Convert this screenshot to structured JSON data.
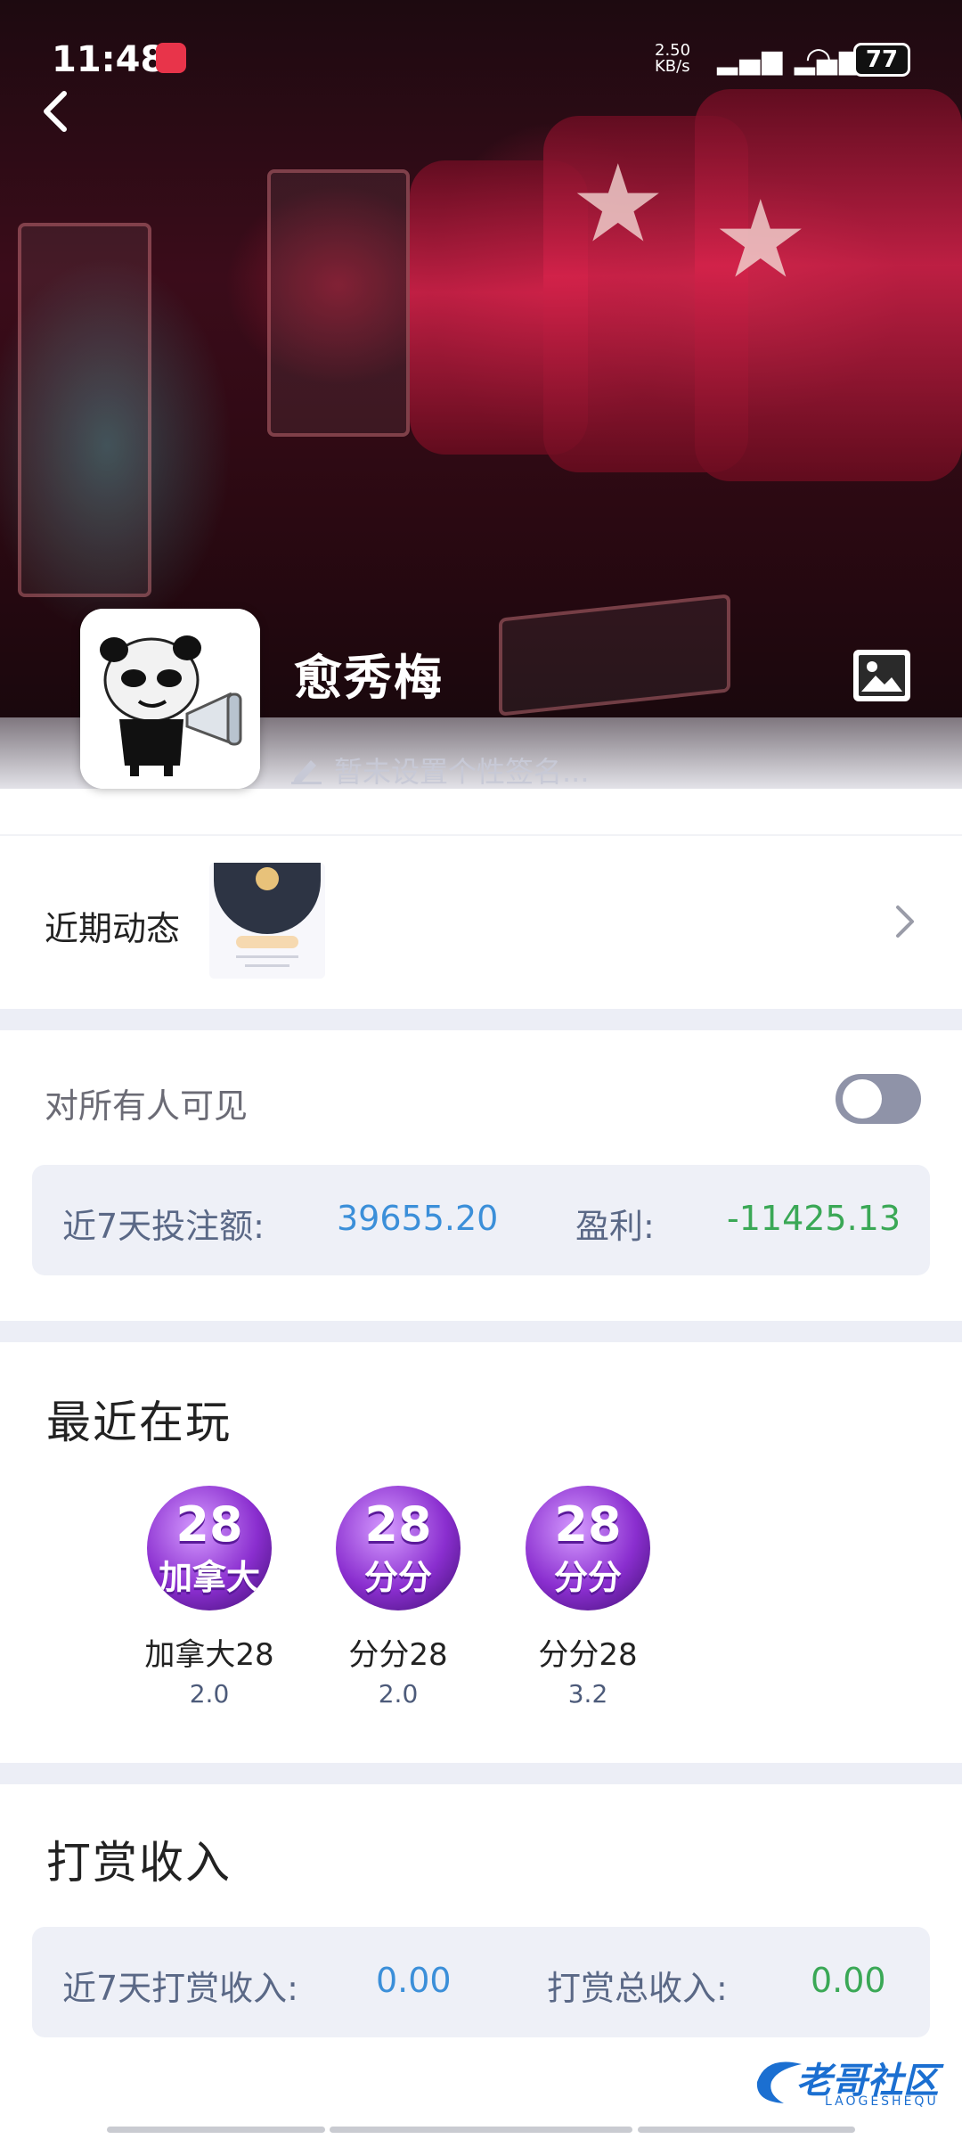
{
  "status_bar": {
    "time": "11:48",
    "network_speed": "2.50 KB/s",
    "signal": "4G 4G",
    "battery": "77"
  },
  "profile": {
    "username": "愈秀梅",
    "signature_placeholder": "暂未设置个性签名..."
  },
  "recent_activity": {
    "label": "近期动态"
  },
  "visibility": {
    "label": "对所有人可见",
    "enabled": false
  },
  "betting_stats": {
    "bet_label": "近7天投注额:",
    "bet_value": "39655.20",
    "profit_label": "盈利:",
    "profit_value": "-11425.13"
  },
  "recently_played": {
    "title": "最近在玩",
    "games": [
      {
        "icon_num": "28",
        "icon_sub": "加拿大",
        "name": "加拿大28",
        "version": "2.0"
      },
      {
        "icon_num": "28",
        "icon_sub": "分分",
        "name": "分分28",
        "version": "2.0"
      },
      {
        "icon_num": "28",
        "icon_sub": "分分",
        "name": "分分28",
        "version": "3.2"
      }
    ]
  },
  "tip_income": {
    "title": "打赏收入",
    "week_label": "近7天打赏收入:",
    "week_value": "0.00",
    "total_label": "打赏总收入:",
    "total_value": "0.00"
  },
  "watermark": {
    "text": "老哥社区",
    "sub": "LAOGESHEQU"
  },
  "colors": {
    "accent_blue": "#3b8fd9",
    "profit_green": "#3aa856",
    "section_bg": "#eef0f7"
  }
}
